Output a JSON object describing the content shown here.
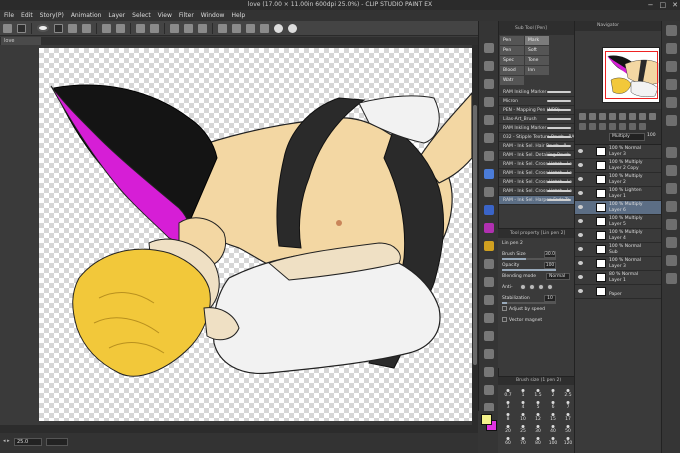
{
  "window": {
    "title": "love (17.00 × 11.00in 600dpi 25.0%) - CLIP STUDIO PAINT EX",
    "controls": [
      "−",
      "□",
      "✕"
    ]
  },
  "menu": [
    "File",
    "Edit",
    "Story(P)",
    "Animation",
    "Layer",
    "Select",
    "View",
    "Filter",
    "Window",
    "Help"
  ],
  "document_tab": "love",
  "status": {
    "zoom": "25.0",
    "arrows": "◂ ▸"
  },
  "subtool": {
    "header": "Sub Tool [Pen]",
    "tabs": [
      "Pen",
      "Mark",
      "Pen",
      "Soft",
      "Spec",
      "Tone",
      "Blood",
      "Inn",
      "Watr",
      "Brstn"
    ],
    "brushes": [
      "RAM Inkling Marker",
      "Micron",
      "PEN - Mapping Pen (NBB)",
      "Lilas-Art_Brush",
      "RAM Inkling Marker",
      "032 - Stipple Texture Brush - RA",
      "RAM - Ink Sel. Hair Brush - 8",
      "RAM - Ink Sel. Detailing Brush",
      "RAM - Ink Sel. Cross Hatch - Lo",
      "RAM - Ink Sel. Cross Hatch - Lo",
      "RAM - Ink Sel. Cross Hatch - Lo",
      "RAM - Ink Sel. Cross Hatch - Lo",
      "RAM - Ink Sel. Harpen Fade-To"
    ],
    "selected_index": 12
  },
  "toolprop": {
    "header": "Tool property [Lin pen 2]",
    "name": "Lin pen 2",
    "brush_size_label": "Brush Size",
    "brush_size": "30.0",
    "brush_size_fraction": 0.45,
    "opacity_label": "Opacity",
    "opacity": "100",
    "opacity_fraction": 1.0,
    "blending_label": "Blending mode",
    "blending": "Normal",
    "aliasing_label": "Anti-",
    "stabilization_label": "Stabilization",
    "stabilization": "10",
    "stabilization_fraction": 0.1,
    "adjust_speed": "Adjust by speed",
    "vector_magnet": "Vector magnet"
  },
  "brushsize": {
    "header": "Brush size (1 pen 2)",
    "sizes": [
      "0.7",
      "1",
      "1.5",
      "2",
      "2.5",
      "3",
      "4",
      "5",
      "6",
      "7",
      "8",
      "10",
      "12",
      "15",
      "17",
      "20",
      "25",
      "30",
      "40",
      "50",
      "60",
      "70",
      "80",
      "100",
      "120"
    ]
  },
  "navigator": {
    "header": "Navigator"
  },
  "layers": {
    "blend_mode": "Multiply",
    "opacity": "100",
    "items": [
      {
        "line1": "100 % Normal",
        "line2": "Layer 3",
        "selected": false
      },
      {
        "line1": "100 % Multiply",
        "line2": "Layer 2 Copy",
        "selected": false
      },
      {
        "line1": "100 % Multiply",
        "line2": "Layer 2",
        "selected": false
      },
      {
        "line1": "100 % Lighten",
        "line2": "Layer 1",
        "selected": false
      },
      {
        "line1": "100 % Multiply",
        "line2": "Layer 6",
        "selected": true
      },
      {
        "line1": "100 % Multiply",
        "line2": "Layer 5",
        "selected": false
      },
      {
        "line1": "100 % Multiply",
        "line2": "Layer 4",
        "selected": false
      },
      {
        "line1": "100 % Normal",
        "line2": "Sub",
        "selected": false
      },
      {
        "line1": "100 % Normal",
        "line2": "Layer 3",
        "selected": false
      },
      {
        "line1": "80 % Normal",
        "line2": "Layer 1",
        "selected": false
      },
      {
        "line1": "",
        "line2": "Paper",
        "selected": false
      }
    ]
  },
  "colors": {
    "foreground": "#f4f18a",
    "background": "#e033e0",
    "accent_selection": "#5c6e85"
  }
}
